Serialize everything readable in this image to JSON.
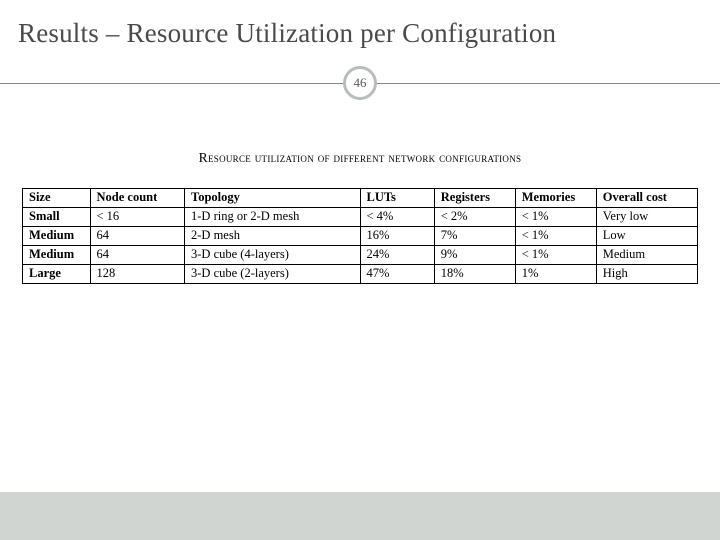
{
  "title": "Results – Resource Utilization per Configuration",
  "page_number": "46",
  "table_caption": "Resource utilization of different network configurations",
  "columns": [
    "Size",
    "Node count",
    "Topology",
    "LUTs",
    "Registers",
    "Memories",
    "Overall cost"
  ],
  "rows": [
    {
      "size": "Small",
      "node_count": "< 16",
      "topology": "1-D ring or 2-D mesh",
      "luts": "< 4%",
      "registers": "< 2%",
      "memories": "< 1%",
      "overall_cost": "Very low"
    },
    {
      "size": "Medium",
      "node_count": "64",
      "topology": "2-D mesh",
      "luts": "16%",
      "registers": "7%",
      "memories": "< 1%",
      "overall_cost": "Low"
    },
    {
      "size": "Medium",
      "node_count": "64",
      "topology": "3-D cube (4-layers)",
      "luts": "24%",
      "registers": "9%",
      "memories": "< 1%",
      "overall_cost": "Medium"
    },
    {
      "size": "Large",
      "node_count": "128",
      "topology": "3-D cube (2-layers)",
      "luts": "47%",
      "registers": "18%",
      "memories": "1%",
      "overall_cost": "High"
    }
  ],
  "chart_data": {
    "type": "table",
    "title": "Resource utilization of different network configurations",
    "columns": [
      "Size",
      "Node count",
      "Topology",
      "LUTs",
      "Registers",
      "Memories",
      "Overall cost"
    ],
    "rows": [
      [
        "Small",
        "< 16",
        "1-D ring or 2-D mesh",
        "< 4%",
        "< 2%",
        "< 1%",
        "Very low"
      ],
      [
        "Medium",
        "64",
        "2-D mesh",
        "16%",
        "7%",
        "< 1%",
        "Low"
      ],
      [
        "Medium",
        "64",
        "3-D cube (4-layers)",
        "24%",
        "9%",
        "< 1%",
        "Medium"
      ],
      [
        "Large",
        "128",
        "3-D cube (2-layers)",
        "47%",
        "18%",
        "1%",
        "High"
      ]
    ]
  }
}
